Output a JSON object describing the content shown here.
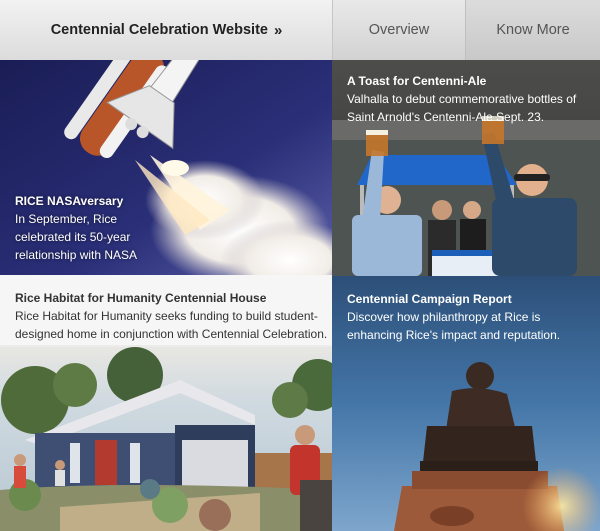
{
  "nav": {
    "main_label": "Centennial Celebration Website",
    "overview_label": "Overview",
    "know_more_label": "Know More"
  },
  "tiles": {
    "nasa": {
      "title": "RICE NASAversary",
      "text": "In September, Rice celebrated its 50-year relationship with NASA"
    },
    "ale": {
      "title": "A Toast for Centenni-Ale",
      "text": "Valhalla to debut commemorative bottles of Saint Arnold's Centenni-Ale Sept. 23."
    },
    "habitat": {
      "title": "Rice Habitat for Humanity Centennial House",
      "text": "Rice Habitat for Humanity seeks funding to build student-designed home in conjunction with Centennial Celebration."
    },
    "campaign": {
      "title": "Centennial Campaign Report",
      "text": "Discover how philanthropy at Rice is enhancing Rice's impact and reputation."
    }
  }
}
